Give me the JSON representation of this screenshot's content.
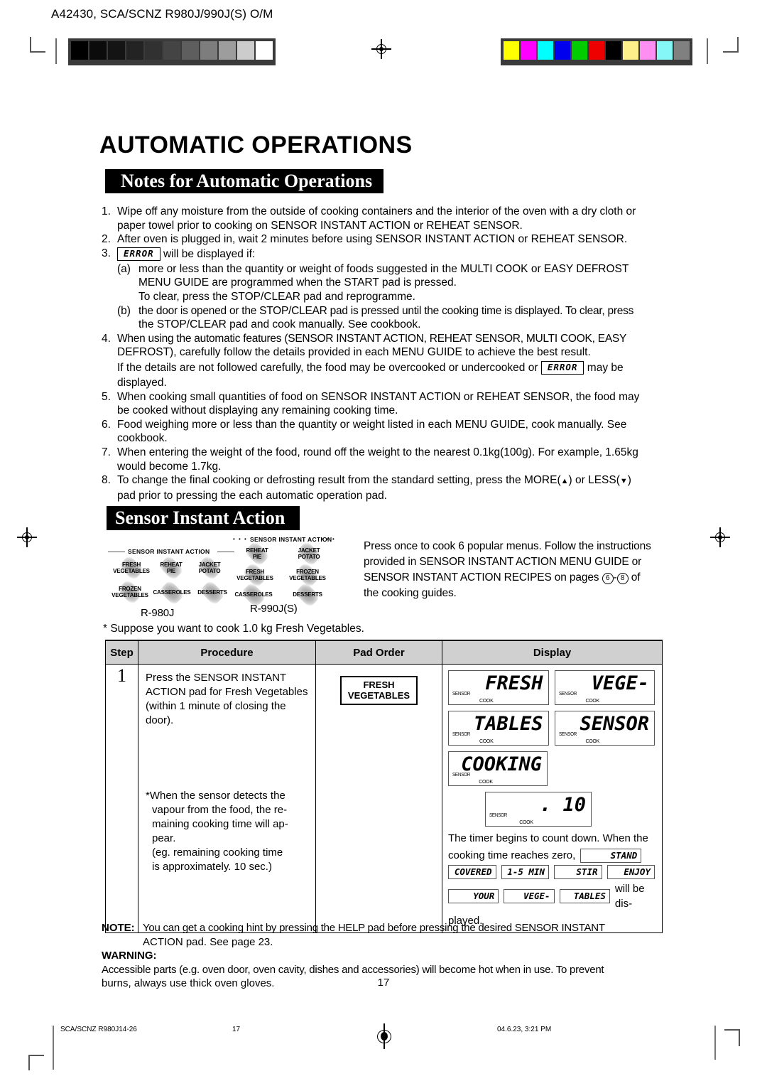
{
  "prepress": {
    "title": "A42430, SCA/SCNZ R980J/990J(S) O/M",
    "grey_ramp": [
      "#000000",
      "#0b0b0b",
      "#141414",
      "#232323",
      "#313131",
      "#444444",
      "#5e5e5e",
      "#7d7d7d",
      "#9d9d9d",
      "#cccccc",
      "#ffffff"
    ],
    "color_bar": [
      "#ffff00",
      "#ff00ff",
      "#00ffff",
      "#0000ee",
      "#00cc00",
      "#ee0000",
      "#000000",
      "#ffef8a",
      "#ff8ef2",
      "#85f7f7",
      "#808080"
    ]
  },
  "header": {
    "main_title": "AUTOMATIC OPERATIONS",
    "notes_heading": "Notes for Automatic Operations",
    "sia_heading": "Sensor Instant Action"
  },
  "notes": {
    "n1": {
      "num": "1.",
      "line1": "Wipe off any moisture from the outside of cooking containers and the interior of the oven with a dry cloth or",
      "line2": "paper towel prior to cooking on SENSOR INSTANT ACTION or REHEAT SENSOR."
    },
    "n2": {
      "num": "2.",
      "line1": "After oven is plugged in, wait 2 minutes before using SENSOR INSTANT ACTION or REHEAT SENSOR."
    },
    "n3": {
      "num": "3.",
      "lcd": "ERROR",
      "after_lcd": "will be displayed if:",
      "a_label": "(a)",
      "a_line1": "more or less than the quantity or weight of foods suggested in the MULTI COOK or EASY DEFROST",
      "a_line2": "MENU GUIDE are programmed when the START pad is pressed.",
      "a_line3": "To clear, press the STOP/CLEAR pad and reprogramme.",
      "b_label": "(b)",
      "b_line1": "the door is opened or the STOP/CLEAR pad is pressed until the cooking time is displayed. To clear, press",
      "b_line2": "the STOP/CLEAR pad and cook manually. See cookbook."
    },
    "n4": {
      "num": "4.",
      "line1": "When using the automatic features (SENSOR INSTANT ACTION, REHEAT SENSOR, MULTI COOK, EASY",
      "line2": "DEFROST), carefully follow the details provided in each MENU GUIDE to achieve the best result.",
      "line3a": "If the details are not followed carefully, the food may be overcooked or undercooked or",
      "lcd": "ERROR",
      "line3b": "may be",
      "line4": "displayed."
    },
    "n5": {
      "num": "5.",
      "line1": "When cooking small quantities of food on SENSOR INSTANT ACTION or REHEAT SENSOR, the food may",
      "line2": "be cooked without displaying any remaining cooking time."
    },
    "n6": {
      "num": "6.",
      "line1": "Food weighing more or less than the quantity or weight listed in each MENU GUIDE, cook manually. See",
      "line2": "cookbook."
    },
    "n7": {
      "num": "7.",
      "line1": "When entering the weight of the food, round off the weight to the nearest 0.1kg(100g). For example, 1.65kg",
      "line2": "would become 1.7kg."
    },
    "n8": {
      "num": "8.",
      "line1a": "To change the final cooking or defrosting result from the standard setting, press the MORE(",
      "more_arrow": "▲",
      "line1b": ") or LESS(",
      "less_arrow": "▼",
      "line1c": ")",
      "line2": "pad prior to pressing the each automatic operation pad."
    }
  },
  "panels": {
    "p980": {
      "model": "R-980J",
      "header": "SENSOR INSTANT ACTION",
      "pads": [
        {
          "l1": "FRESH",
          "l2": "VEGETABLES"
        },
        {
          "l1": "REHEAT",
          "l2": "PIE"
        },
        {
          "l1": "JACKET",
          "l2": "POTATO"
        },
        {
          "l1": "FROZEN",
          "l2": "VEGETABLES"
        },
        {
          "l1": "CASSEROLES",
          "l2": ""
        },
        {
          "l1": "DESSERTS",
          "l2": ""
        }
      ]
    },
    "p990": {
      "model": "R-990J(S)",
      "header": "SENSOR INSTANT ACTION",
      "dots_left": "• • •",
      "dots_right": "• • •",
      "pads": [
        {
          "l1": "REHEAT",
          "l2": "PIE"
        },
        {
          "l1": "JACKET",
          "l2": "POTATO"
        },
        {
          "l1": "FRESH",
          "l2": "VEGETABLES"
        },
        {
          "l1": "FROZEN",
          "l2": "VEGETABLES"
        },
        {
          "l1": "CASSEROLES",
          "l2": ""
        },
        {
          "l1": "DESSERTS",
          "l2": ""
        }
      ]
    }
  },
  "sia_desc": {
    "line1": "Press once to cook 6 popular menus. Follow the instructions",
    "line2": "provided in SENSOR INSTANT ACTION MENU GUIDE or",
    "line3a": "SENSOR INSTANT ACTION RECIPES on pages",
    "page_from": "6",
    "dash": "-",
    "page_to": "8",
    "line3b": "of",
    "line4": "the cooking guides."
  },
  "suppose": "*  Suppose you want to cook 1.0 kg Fresh Vegetables.",
  "table": {
    "headers": [
      "Step",
      "Procedure",
      "Pad Order",
      "Display"
    ],
    "row": {
      "step": "1",
      "procedure_a": "Press the SENSOR INSTANT ACTION pad for Fresh Vegetables (within 1 minute of closing the door).",
      "procedure_b_l1": "*When the sensor detects the",
      "procedure_b_l2": "vapour from the food, the re-",
      "procedure_b_l3": "maining cooking time will ap-",
      "procedure_b_l4": "pear.",
      "procedure_b_l5": " (eg. remaining cooking time",
      "procedure_b_l6": "is approximately. 10 sec.)",
      "pad_button_l1": "FRESH",
      "pad_button_l2": "VEGETABLES",
      "displays": [
        {
          "text": "FRESH",
          "sensor": "SENSOR",
          "cook": "COOK"
        },
        {
          "text": "VEGE-",
          "sensor": "SENSOR",
          "cook": "COOK"
        },
        {
          "text": "TABLES",
          "sensor": "SENSOR",
          "cook": "COOK"
        },
        {
          "text": "SENSOR",
          "sensor": "SENSOR",
          "cook": "COOK"
        },
        {
          "text": "COOKING",
          "sensor": "SENSOR",
          "cook": "COOK"
        }
      ],
      "timer_display": {
        "text": ". 10",
        "sensor": "SENSOR",
        "cook": "COOK"
      },
      "closing_l1": "The timer begins to count down. When the",
      "closing_l2": "cooking  time  reaches  zero,",
      "closing_tags_row1": [
        "STAND"
      ],
      "closing_tags_row2": [
        "COVERED",
        "1-5 MIN",
        "STIR",
        "ENJOY"
      ],
      "closing_tags_row3": [
        "YOUR",
        "VEGE-",
        "TABLES"
      ],
      "closing_l3": "will be dis-",
      "closing_l4": "played."
    }
  },
  "bottom": {
    "note_label": "NOTE:",
    "note_l1": "You can get a cooking hint by pressing the HELP pad before pressing the desired SENSOR INSTANT",
    "note_l2": "ACTION pad. See page 23.",
    "warning_label": "WARNING:",
    "warning_l1": "Accessible parts (e.g. oven door, oven cavity, dishes and accessories) will become hot when in use. To prevent",
    "warning_l2": "burns, always use thick oven gloves.",
    "page_number": "17"
  },
  "footer": {
    "left": "SCA/SCNZ R980J14-26",
    "center": "17",
    "right": "04.6.23, 3:21 PM"
  }
}
